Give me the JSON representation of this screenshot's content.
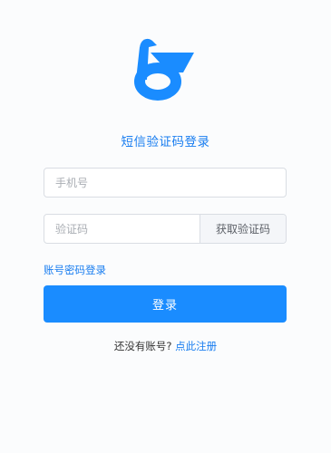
{
  "brand": {
    "logo_icon": "blue-bird-logo-icon",
    "accent_color": "#1a8cff"
  },
  "heading": "短信验证码登录",
  "form": {
    "phone_placeholder": "手机号",
    "phone_value": "",
    "code_placeholder": "验证码",
    "code_value": "",
    "get_code_label": "获取验证码",
    "password_login_label": "账号密码登录",
    "submit_label": "登录"
  },
  "footer": {
    "no_account_text": "还没有账号?",
    "register_label": "点此注册"
  }
}
